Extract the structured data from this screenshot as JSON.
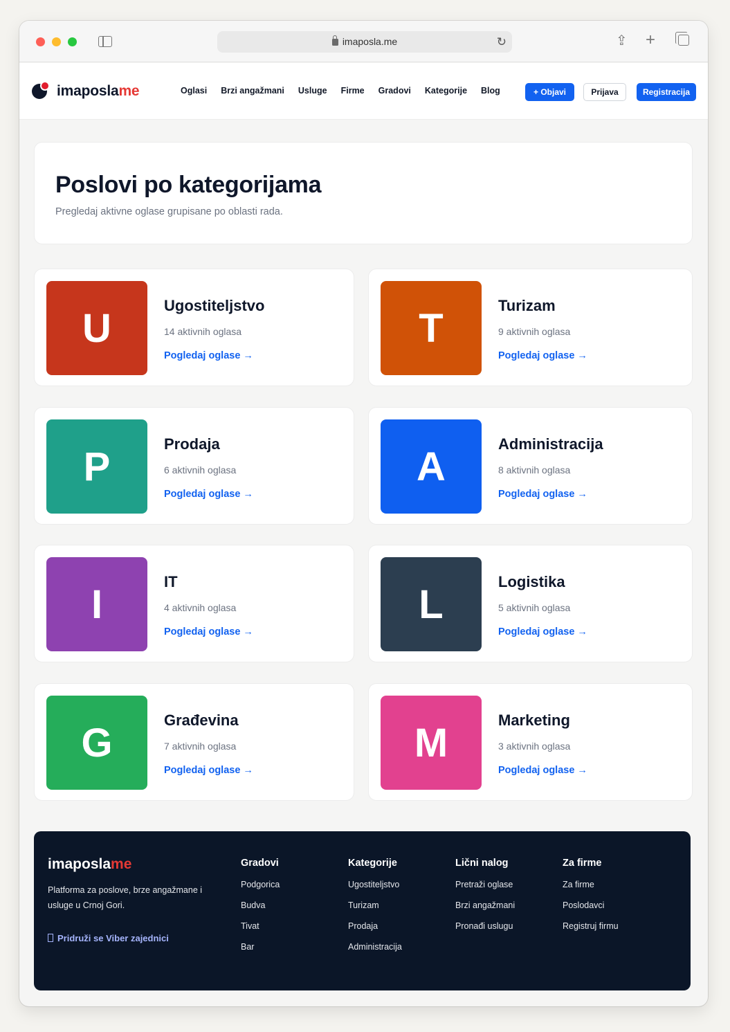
{
  "browser": {
    "url": "imaposla.me"
  },
  "nav": {
    "logo_main": "imaposla",
    "logo_accent": "me",
    "links": [
      "Oglasi",
      "Brzi angažmani",
      "Usluge",
      "Firme",
      "Gradovi",
      "Kategorije",
      "Blog"
    ],
    "publish_label": "+ Objavi",
    "login_label": "Prijava",
    "register_label": "Registracija"
  },
  "hero": {
    "title": "Poslovi po kategorijama",
    "subtitle": "Pregledaj aktivne oglase grupisane po oblasti rada."
  },
  "categories": [
    {
      "letter": "U",
      "name": "Ugostiteljstvo",
      "count": "14 aktivnih oglasa",
      "link": "Pogledaj oglase →",
      "color": "#c6361c"
    },
    {
      "letter": "T",
      "name": "Turizam",
      "count": "9 aktivnih oglasa",
      "link": "Pogledaj oglase →",
      "color": "#d05207"
    },
    {
      "letter": "P",
      "name": "Prodaja",
      "count": "6 aktivnih oglasa",
      "link": "Pogledaj oglase →",
      "color": "#1fa08a"
    },
    {
      "letter": "A",
      "name": "Administracija",
      "count": "8 aktivnih oglasa",
      "link": "Pogledaj oglase →",
      "color": "#0f5ff0"
    },
    {
      "letter": "I",
      "name": "IT",
      "count": "4 aktivnih oglasa",
      "link": "Pogledaj oglase →",
      "color": "#8e42b0"
    },
    {
      "letter": "L",
      "name": "Logistika",
      "count": "5 aktivnih oglasa",
      "link": "Pogledaj oglase →",
      "color": "#2c3e50"
    },
    {
      "letter": "G",
      "name": "Građevina",
      "count": "7 aktivnih oglasa",
      "link": "Pogledaj oglase →",
      "color": "#25ad5a"
    },
    {
      "letter": "M",
      "name": "Marketing",
      "count": "3 aktivnih oglasa",
      "link": "Pogledaj oglase →",
      "color": "#e2418f"
    }
  ],
  "footer": {
    "logo_main": "imaposla",
    "logo_accent": "me",
    "description": "Platforma za poslove, brze angažmane i usluge u Crnoj Gori.",
    "viber_label": "Pridruži se Viber zajednici",
    "columns": [
      {
        "title": "Gradovi",
        "links": [
          "Podgorica",
          "Budva",
          "Tivat",
          "Bar"
        ]
      },
      {
        "title": "Kategorije",
        "links": [
          "Ugostiteljstvo",
          "Turizam",
          "Prodaja",
          "Administracija"
        ]
      },
      {
        "title": "Lični nalog",
        "links": [
          "Pretraži oglase",
          "Brzi angažmani",
          "Pronađi uslugu"
        ]
      },
      {
        "title": "Za firme",
        "links": [
          "Za firme",
          "Poslodavci",
          "Registruj firmu"
        ]
      }
    ]
  }
}
